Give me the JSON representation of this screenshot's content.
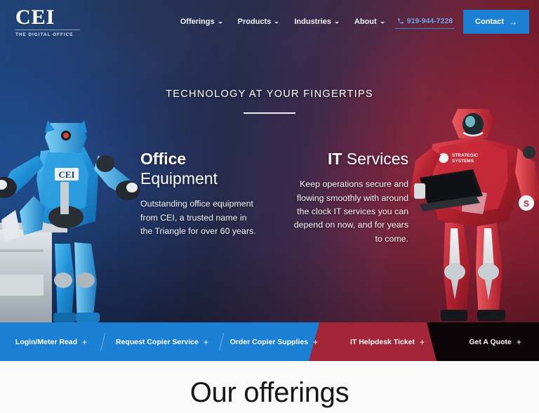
{
  "header": {
    "logo": {
      "mark": "CEI",
      "tagline": "THE DIGITAL OFFICE"
    },
    "nav_items": [
      {
        "label": "Offerings",
        "has_dropdown": true
      },
      {
        "label": "Products",
        "has_dropdown": true
      },
      {
        "label": "Industries",
        "has_dropdown": true
      },
      {
        "label": "About",
        "has_dropdown": true
      }
    ],
    "phone": {
      "number": "919-944-7228",
      "icon": "phone-icon"
    },
    "contact_button": {
      "label": "Contact",
      "arrow": "→",
      "color": "#1b7fd4"
    }
  },
  "hero": {
    "kicker": "TECHNOLOGY AT YOUR FINGERTIPS",
    "columns": [
      {
        "title_bold": "Office",
        "title_light": "Equipment",
        "body": "Outstanding office equipment from CEI, a trusted name in the Triangle for over 60 years."
      },
      {
        "title_bold": "IT",
        "title_light": "Services",
        "body": "Keep operations secure and flowing smoothly with around the clock IT services you can depend on now, and for years to come."
      }
    ],
    "robots": {
      "left": {
        "name": "blue-robot",
        "chest_badge": "CEI",
        "accessory": "copier-machine"
      },
      "right": {
        "name": "red-robot",
        "chest_badge": "STRATEGIC SYSTEMS",
        "accessory": "laptop"
      }
    },
    "colors": {
      "blue": "#1d4f8f",
      "navy": "#252a4a",
      "red": "#8e2236"
    }
  },
  "action_bar": {
    "items": [
      {
        "label": "Login/Meter Read",
        "plus": "+",
        "segment": "blue"
      },
      {
        "label": "Request Copier Service",
        "plus": "+",
        "segment": "blue"
      },
      {
        "label": "Order Copier Supplies",
        "plus": "+",
        "segment": "blue"
      },
      {
        "label": "IT Helpdesk Ticket",
        "plus": "+",
        "segment": "red"
      },
      {
        "label": "Get A Quote",
        "plus": "+",
        "segment": "black"
      }
    ],
    "colors": {
      "blue": "#1b7fd4",
      "red": "#a32638",
      "black": "#0d0608"
    }
  },
  "offerings": {
    "title": "Our offerings"
  }
}
